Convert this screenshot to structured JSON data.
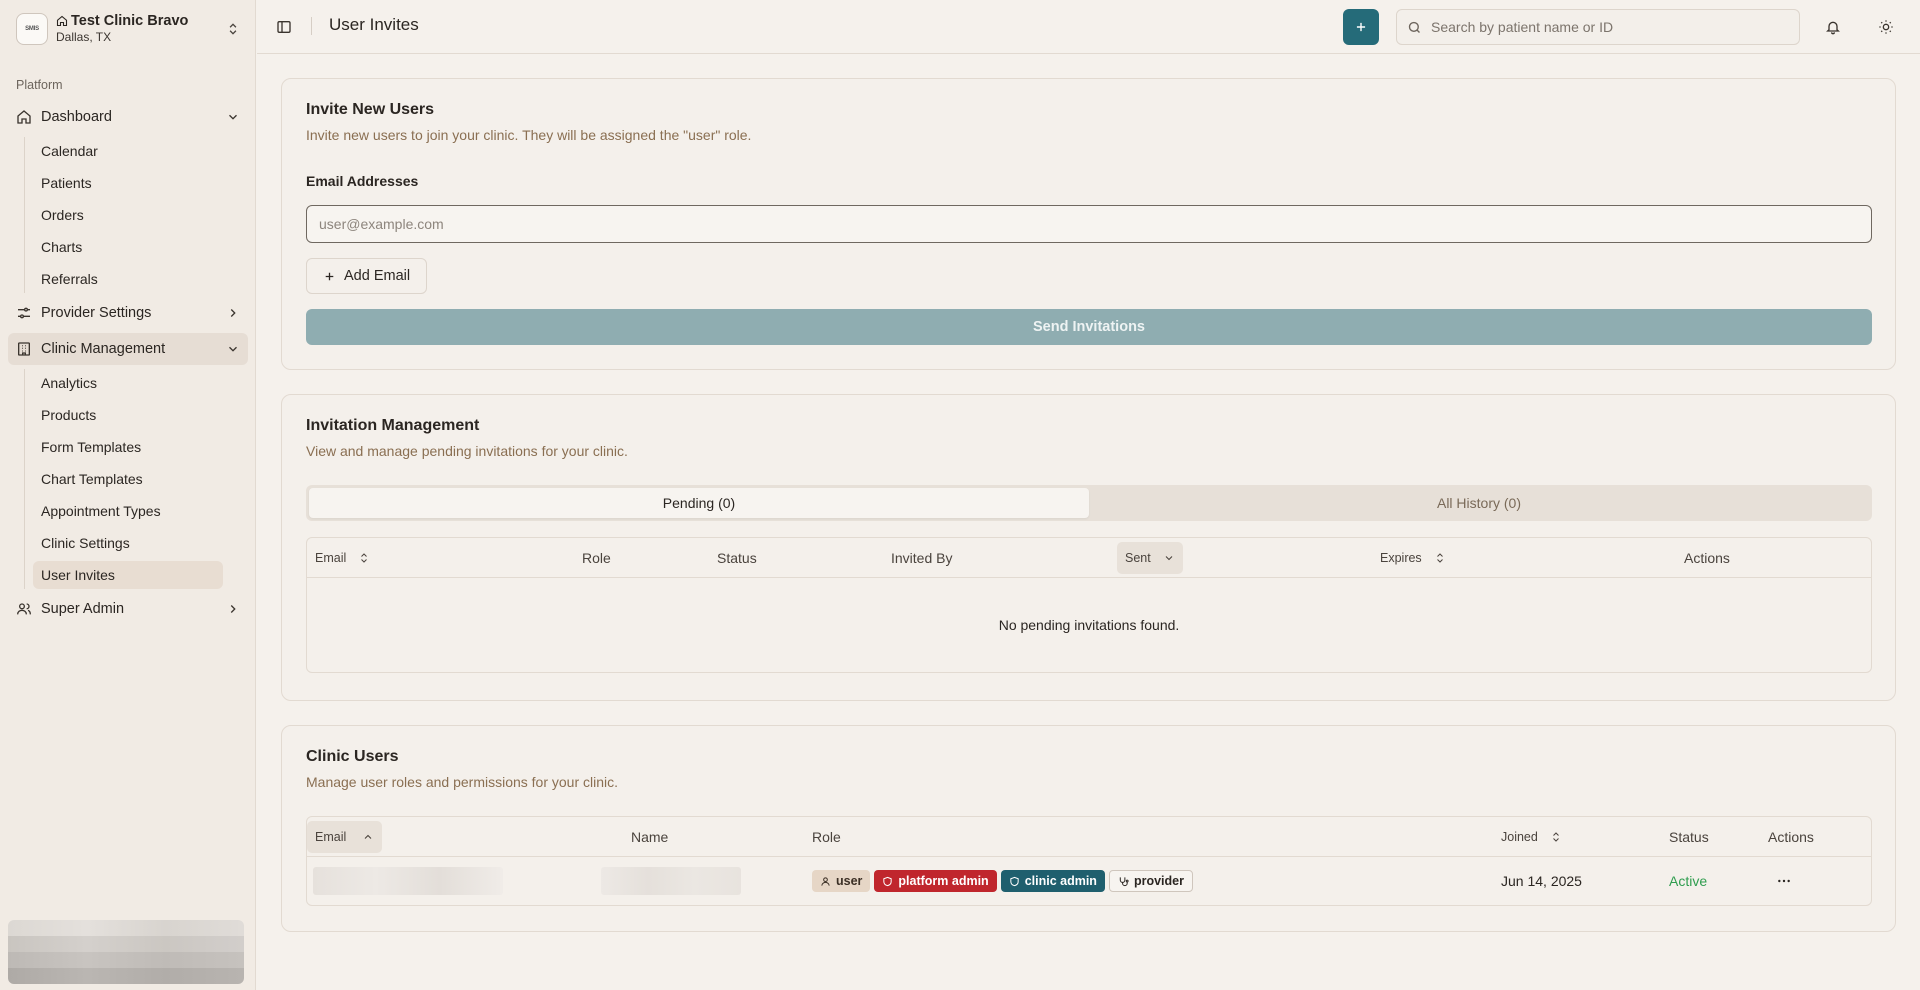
{
  "sidebar": {
    "clinic": {
      "logo_text": "SMIS",
      "name": "Test Clinic Bravo",
      "location": "Dallas, TX"
    },
    "group_label": "Platform",
    "items": [
      {
        "label": "Dashboard",
        "icon": "house-icon",
        "expanded": true,
        "children": [
          "Calendar",
          "Patients",
          "Orders",
          "Charts",
          "Referrals"
        ]
      },
      {
        "label": "Provider Settings",
        "icon": "sliders-icon",
        "expanded": false
      },
      {
        "label": "Clinic Management",
        "icon": "building-icon",
        "expanded": true,
        "children": [
          "Analytics",
          "Products",
          "Form Templates",
          "Chart Templates",
          "Appointment Types",
          "Clinic Settings",
          "User Invites"
        ],
        "active_child": "User Invites"
      },
      {
        "label": "Super Admin",
        "icon": "users-icon",
        "expanded": false
      }
    ]
  },
  "header": {
    "title": "User Invites",
    "search_placeholder": "Search by patient name or ID"
  },
  "invite": {
    "title": "Invite New Users",
    "description": "Invite new users to join your clinic. They will be assigned the \"user\" role.",
    "field_label": "Email Addresses",
    "email_placeholder": "user@example.com",
    "add_email_label": "Add Email",
    "send_label": "Send Invitations"
  },
  "management": {
    "title": "Invitation Management",
    "description": "View and manage pending invitations for your clinic.",
    "tabs": [
      "Pending (0)",
      "All History (0)"
    ],
    "active_tab": "Pending (0)",
    "columns": [
      "Email",
      "Role",
      "Status",
      "Invited By",
      "Sent",
      "Expires",
      "Actions"
    ],
    "empty_text": "No pending invitations found."
  },
  "users": {
    "title": "Clinic Users",
    "description": "Manage user roles and permissions for your clinic.",
    "columns": [
      "Email",
      "Name",
      "Role",
      "Joined",
      "Status",
      "Actions"
    ],
    "rows": [
      {
        "roles": [
          "user",
          "platform admin",
          "clinic admin",
          "provider"
        ],
        "joined": "Jun 14, 2025",
        "status": "Active"
      }
    ]
  },
  "colors": {
    "primary": "#256b79",
    "send_disabled": "#8fadb1",
    "platform_admin": "#c0262d",
    "clinic_admin": "#1f5f6e",
    "status_active": "#2f9d4f",
    "description_text": "#8a6f52"
  }
}
